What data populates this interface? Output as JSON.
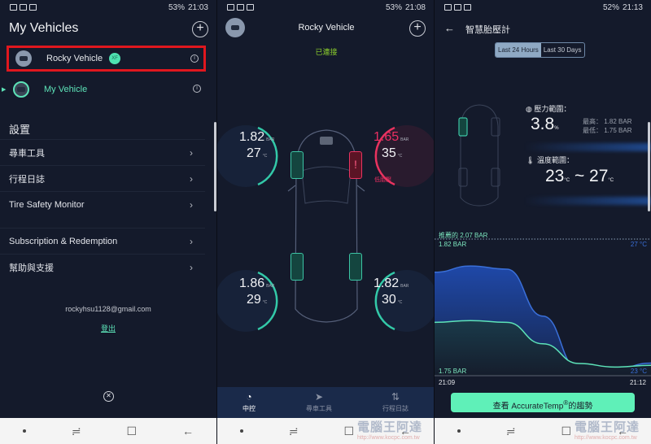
{
  "panel1": {
    "status": {
      "battery": "53%",
      "time": "21:03"
    },
    "title": "My Vehicles",
    "vehicles": [
      {
        "name": "Rocky Vehicle",
        "badge": "XF",
        "selected": true
      },
      {
        "name": "My Vehicle",
        "active": true
      }
    ],
    "settings_header": "設置",
    "menu": [
      {
        "label": "尋車工具"
      },
      {
        "label": "行程日誌"
      },
      {
        "label": "Tire Safety Monitor"
      },
      {
        "label": "Subscription & Redemption"
      },
      {
        "label": "幫助與支援"
      }
    ],
    "email": "rockyhsu1128@gmail.com",
    "logout": "登出"
  },
  "panel2": {
    "status": {
      "battery": "53%",
      "time": "21:08"
    },
    "title": "Rocky Vehicle",
    "connection": "已連接",
    "tires": {
      "front_left": {
        "pressure": "1.82",
        "temp": "27",
        "status": "ok"
      },
      "front_right": {
        "pressure": "1.65",
        "temp": "35",
        "status": "low",
        "warning": "低胎壓"
      },
      "rear_left": {
        "pressure": "1.86",
        "temp": "29",
        "status": "ok"
      },
      "rear_right": {
        "pressure": "1.82",
        "temp": "30",
        "status": "ok"
      }
    },
    "units": {
      "pressure": "BAR",
      "temp": "°C"
    },
    "tabs": [
      {
        "label": "中控",
        "icon": "dashboard-icon",
        "active": true
      },
      {
        "label": "尋車工具",
        "icon": "navigation-icon"
      },
      {
        "label": "行程日誌",
        "icon": "trip-log-icon"
      }
    ]
  },
  "panel3": {
    "status": {
      "battery": "52%",
      "time": "21:13"
    },
    "title": "智慧胎壓計",
    "segments": [
      "Last 24 Hours",
      "Last 30 Days"
    ],
    "pressure_range_label": "壓力範圍：",
    "pressure_range_value": "3.8",
    "pressure_range_unit": "%",
    "max_label": "最高：",
    "max_value": "1.82 BAR",
    "min_label": "最低：",
    "min_value": "1.75 BAR",
    "temp_range_label": "溫度範圍：",
    "temp_low": "23",
    "temp_high": "27",
    "temp_unit": "°C",
    "tilde": "~",
    "chart": {
      "recommended": "推薦的 2.07 BAR",
      "p_max": "1.82 BAR",
      "p_min": "1.75 BAR",
      "t_max": "27 °C",
      "t_min": "23 °C",
      "x_start": "21:09",
      "x_end": "21:12"
    },
    "cta": "查看 AccurateTemp",
    "cta_suffix": "的趨勢",
    "colors": {
      "pressure_line": "#5de3b8",
      "temp_line": "#3a6fd8",
      "cta": "#5ff0b8"
    }
  },
  "nav": {
    "watermark": "電腦王阿達",
    "watermark_url": "http://www.kocpc.com.tw"
  },
  "chart_data": {
    "type": "line",
    "title": "智慧胎壓計 - Last 24 Hours",
    "x": [
      "21:09",
      "",
      "",
      "",
      "",
      "",
      "21:12"
    ],
    "series": [
      {
        "name": "Temperature (°C)",
        "values": [
          26.2,
          26.4,
          26.3,
          24.8,
          23.1,
          23.1,
          23.3
        ],
        "range": [
          23,
          27
        ]
      },
      {
        "name": "Pressure (BAR)",
        "values": [
          1.778,
          1.779,
          1.778,
          1.766,
          1.755,
          1.753,
          1.754
        ],
        "range": [
          1.75,
          1.82
        ]
      }
    ],
    "annotations": [
      "推薦的 2.07 BAR"
    ],
    "xlabel": "",
    "ylabel": ""
  }
}
